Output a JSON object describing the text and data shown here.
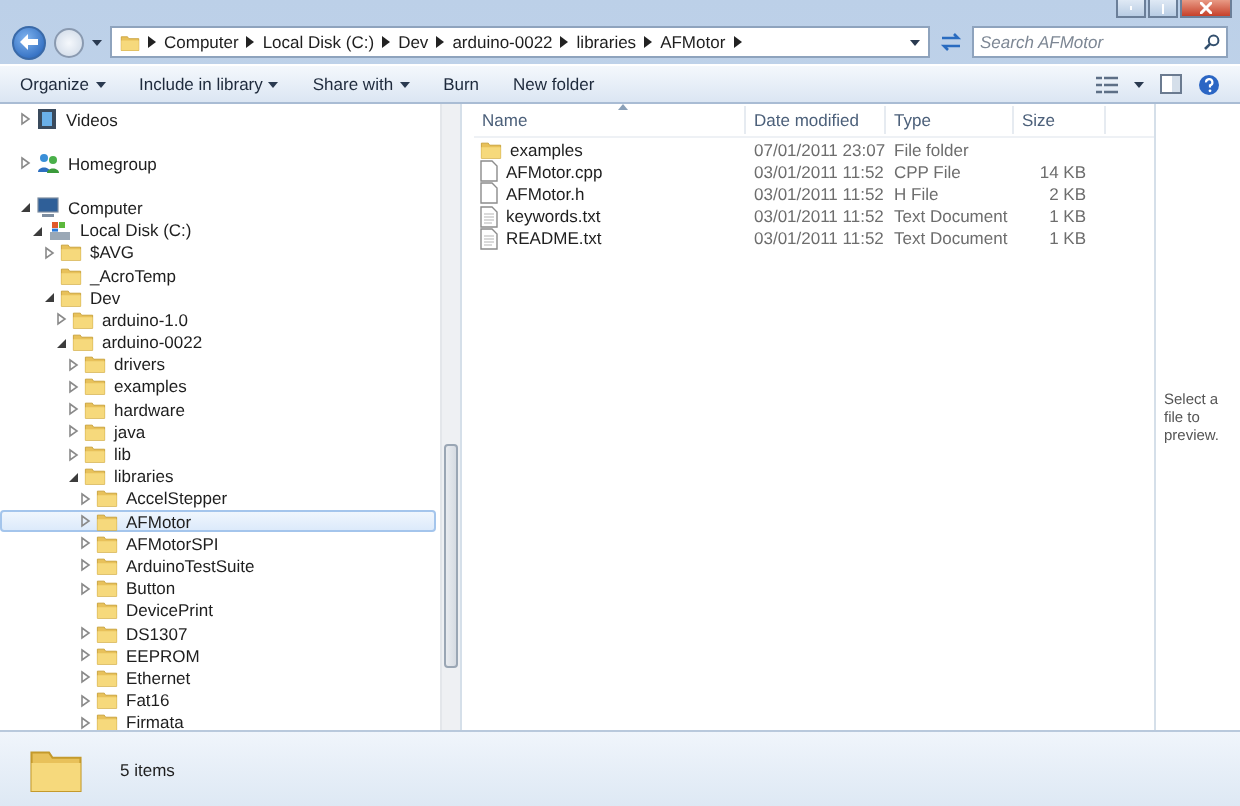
{
  "address_bar": {
    "crumbs": [
      "Computer",
      "Local Disk (C:)",
      "Dev",
      "arduino-0022",
      "libraries",
      "AFMotor"
    ],
    "search": {
      "placeholder": "Search AFMotor"
    }
  },
  "toolbar": {
    "buttons": [
      {
        "label": "Organize",
        "dropdown": true
      },
      {
        "label": "Include in library",
        "dropdown": true
      },
      {
        "label": "Share with",
        "dropdown": true
      },
      {
        "label": "Burn",
        "dropdown": false
      },
      {
        "label": "New folder",
        "dropdown": false
      }
    ]
  },
  "nav_tree": [
    {
      "label": "Videos",
      "kind": "videos",
      "expandable": true,
      "expanded": false,
      "selected": false
    },
    {
      "label": "Homegroup",
      "kind": "homegroup",
      "expandable": true,
      "expanded": false,
      "selected": false
    },
    {
      "label": "Computer",
      "kind": "computer",
      "expandable": true,
      "expanded": true,
      "selected": false,
      "children": [
        {
          "label": "Local Disk (C:)",
          "kind": "drive",
          "expandable": true,
          "expanded": true,
          "selected": false,
          "children": [
            {
              "label": "$AVG",
              "expandable": true,
              "expanded": false,
              "selected": false
            },
            {
              "label": "_AcroTemp",
              "expandable": false,
              "expanded": false,
              "selected": false
            },
            {
              "label": "Dev",
              "expandable": true,
              "expanded": true,
              "selected": false,
              "children": [
                {
                  "label": "arduino-1.0",
                  "expandable": true,
                  "expanded": false,
                  "selected": false
                },
                {
                  "label": "arduino-0022",
                  "expandable": true,
                  "expanded": true,
                  "selected": false,
                  "children": [
                    {
                      "label": "drivers",
                      "expandable": true,
                      "expanded": false,
                      "selected": false
                    },
                    {
                      "label": "examples",
                      "expandable": true,
                      "expanded": false,
                      "selected": false
                    },
                    {
                      "label": "hardware",
                      "expandable": true,
                      "expanded": false,
                      "selected": false
                    },
                    {
                      "label": "java",
                      "expandable": true,
                      "expanded": false,
                      "selected": false
                    },
                    {
                      "label": "lib",
                      "expandable": true,
                      "expanded": false,
                      "selected": false
                    },
                    {
                      "label": "libraries",
                      "expandable": true,
                      "expanded": true,
                      "selected": false,
                      "children": [
                        {
                          "label": "AccelStepper",
                          "expandable": true,
                          "expanded": false,
                          "selected": false
                        },
                        {
                          "label": "AFMotor",
                          "expandable": true,
                          "expanded": false,
                          "selected": true
                        },
                        {
                          "label": "AFMotorSPI",
                          "expandable": true,
                          "expanded": false,
                          "selected": false
                        },
                        {
                          "label": "ArduinoTestSuite",
                          "expandable": true,
                          "expanded": false,
                          "selected": false
                        },
                        {
                          "label": "Button",
                          "expandable": true,
                          "expanded": false,
                          "selected": false
                        },
                        {
                          "label": "DevicePrint",
                          "expandable": false,
                          "expanded": false,
                          "selected": false
                        },
                        {
                          "label": "DS1307",
                          "expandable": true,
                          "expanded": false,
                          "selected": false
                        },
                        {
                          "label": "EEPROM",
                          "expandable": true,
                          "expanded": false,
                          "selected": false
                        },
                        {
                          "label": "Ethernet",
                          "expandable": true,
                          "expanded": false,
                          "selected": false
                        },
                        {
                          "label": "Fat16",
                          "expandable": true,
                          "expanded": false,
                          "selected": false
                        },
                        {
                          "label": "Firmata",
                          "expandable": true,
                          "expanded": false,
                          "selected": false
                        }
                      ]
                    }
                  ]
                }
              ]
            }
          ]
        }
      ]
    }
  ],
  "file_list": {
    "columns": [
      "Name",
      "Date modified",
      "Type",
      "Size"
    ],
    "rows": [
      {
        "kind": "folder",
        "name": "examples",
        "date": "07/01/2011 23:07",
        "type": "File folder"
      },
      {
        "kind": "file",
        "name": "AFMotor.cpp",
        "date": "03/01/2011 11:52",
        "type": "CPP File",
        "size": "14 KB"
      },
      {
        "kind": "file",
        "name": "AFMotor.h",
        "date": "03/01/2011 11:52",
        "type": "H File",
        "size": "2 KB"
      },
      {
        "kind": "text",
        "name": "keywords.txt",
        "date": "03/01/2011 11:52",
        "type": "Text Document",
        "size": "1 KB"
      },
      {
        "kind": "text",
        "name": "README.txt",
        "date": "03/01/2011 11:52",
        "type": "Text Document",
        "size": "1 KB"
      }
    ]
  },
  "preview_pane": {
    "message": "Select a file to preview."
  },
  "status_bar": {
    "item_count": "5 items"
  }
}
